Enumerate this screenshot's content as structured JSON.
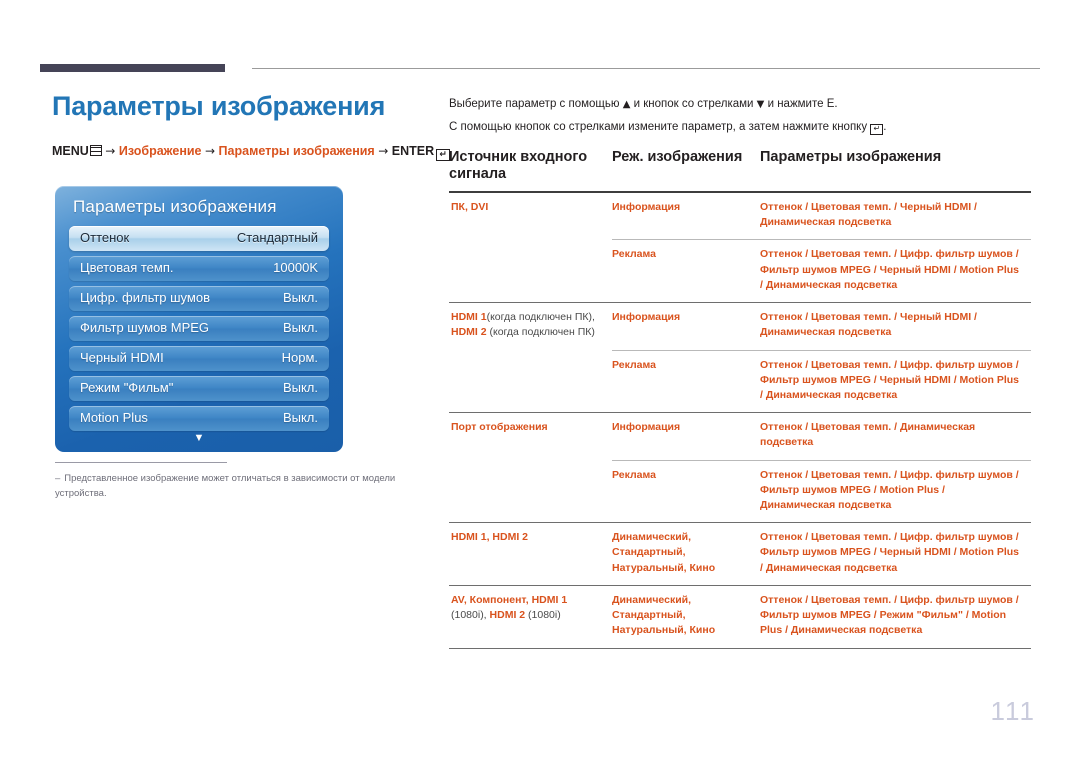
{
  "header": {
    "rule_dark_color": "#454457",
    "rule_line_color": "#9b9b9b"
  },
  "page": {
    "title": "Параметры изображения",
    "title_color": "#2276b6",
    "accent_color": "#d9531e",
    "number": "111"
  },
  "menu_path": {
    "menu_label": "MENU",
    "arrow": "→",
    "step1": "Изображение",
    "step2": "Параметры изображения",
    "enter_label": "ENTER",
    "enter_glyph": "↵"
  },
  "osd": {
    "title": "Параметры изображения",
    "scroll_down_glyph": "▼",
    "items": [
      {
        "label": "Оттенок",
        "value": "Стандартный",
        "selected": true
      },
      {
        "label": "Цветовая темп.",
        "value": "10000K",
        "selected": false
      },
      {
        "label": "Цифр. фильтр шумов",
        "value": "Выкл.",
        "selected": false
      },
      {
        "label": "Фильтр шумов MPEG",
        "value": "Выкл.",
        "selected": false
      },
      {
        "label": "Черный HDMI",
        "value": "Норм.",
        "selected": false
      },
      {
        "label": "Режим \"Фильм\"",
        "value": "Выкл.",
        "selected": false
      },
      {
        "label": "Motion Plus",
        "value": "Выкл.",
        "selected": false
      }
    ]
  },
  "footnote": {
    "dash": "‒",
    "text": "Представленное изображение может отличаться в зависимости от модели устройства."
  },
  "instructions": {
    "line1_part1": "Выберите параметр с помощью",
    "line1_up": "▲",
    "line1_part2": "и кнопок со стрелками",
    "line1_down": "▼",
    "line1_part3": "и нажмите Е.",
    "line2_part1": "С помощью кнопок со стрелками измените параметр, а затем нажмите кнопку",
    "line2_icon": "↵",
    "line2_end": "."
  },
  "table": {
    "headers": {
      "col1": "Источник входного сигнала",
      "col2": "Реж. изображения",
      "col3": "Параметры изображения"
    },
    "rows": [
      {
        "source_main": "ПК, DVI",
        "source_plain": "",
        "modes": [
          {
            "mode": "Информация",
            "options": "Оттенок / Цветовая темп. / Черный HDMI / Динамическая подсветка"
          },
          {
            "mode": "Реклама",
            "options": "Оттенок / Цветовая темп. / Цифр. фильтр шумов / Фильтр шумов MPEG / Черный HDMI / Motion Plus / Динамическая подсветка"
          }
        ]
      },
      {
        "source_main": "HDMI 1",
        "source_plain": "(когда подключен ПК), ",
        "source_main2": "HDMI 2",
        "source_plain2": " (когда подключен ПК)",
        "modes": [
          {
            "mode": "Информация",
            "options": "Оттенок / Цветовая темп. / Черный HDMI / Динамическая подсветка"
          },
          {
            "mode": "Реклама",
            "options": "Оттенок / Цветовая темп. / Цифр. фильтр шумов / Фильтр шумов MPEG / Черный HDMI / Motion Plus / Динамическая подсветка"
          }
        ]
      },
      {
        "source_main": "Порт отображения",
        "source_plain": "",
        "modes": [
          {
            "mode": "Информация",
            "options": "Оттенок / Цветовая темп. / Динамическая подсветка"
          },
          {
            "mode": "Реклама",
            "options": "Оттенок / Цветовая темп. / Цифр. фильтр шумов / Фильтр шумов MPEG / Motion Plus / Динамическая подсветка"
          }
        ]
      },
      {
        "source_main": "HDMI 1, HDMI 2",
        "source_plain": "",
        "modes": [
          {
            "mode": "Динамический, Стандартный, Натуральный, Кино",
            "options": "Оттенок / Цветовая темп. / Цифр. фильтр шумов / Фильтр шумов MPEG / Черный HDMI / Motion Plus / Динамическая подсветка"
          }
        ]
      },
      {
        "source_main": "AV, Компонент, HDMI 1",
        "source_plain": " (1080i), ",
        "source_main2": "HDMI 2",
        "source_plain2": " (1080i)",
        "modes": [
          {
            "mode": "Динамический, Стандартный, Натуральный, Кино",
            "options": "Оттенок / Цветовая темп. / Цифр. фильтр шумов / Фильтр шумов MPEG / Режим \"Фильм\" / Motion Plus / Динамическая подсветка"
          }
        ]
      }
    ]
  }
}
